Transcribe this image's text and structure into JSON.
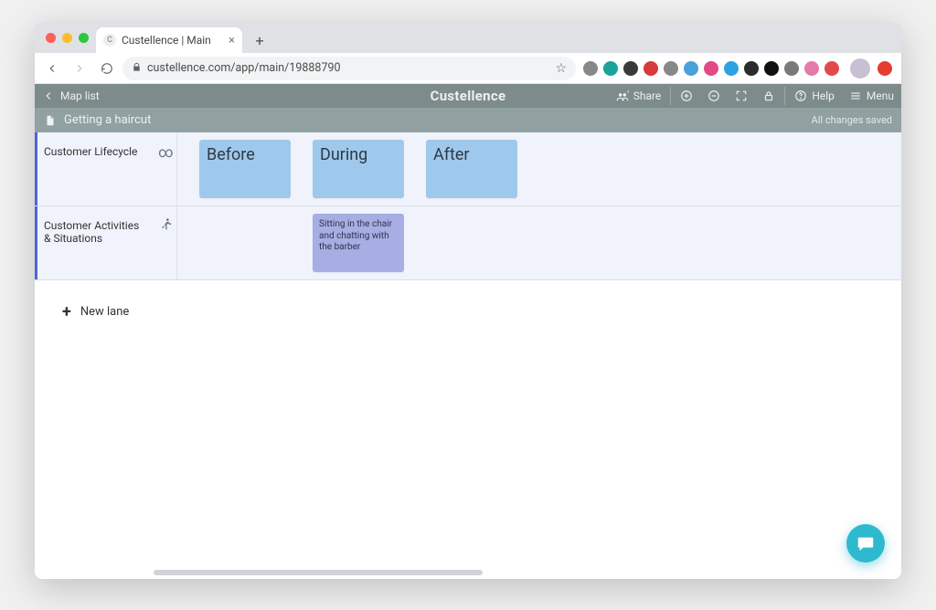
{
  "browser": {
    "tab_title": "Custellence | Main",
    "url": "custellence.com/app/main/19888790"
  },
  "header": {
    "back_label": "Map list",
    "brand": "Custellence",
    "share_label": "Share",
    "help_label": "Help",
    "menu_label": "Menu"
  },
  "doc": {
    "title": "Getting a haircut",
    "saved_status": "All changes saved"
  },
  "icons": {
    "back_arrow": "back-arrow-icon",
    "share": "share-icon",
    "plus_circle": "add-circle-icon",
    "minus_circle": "remove-circle-icon",
    "fullscreen": "fullscreen-icon",
    "lock": "lock-icon",
    "help": "help-circle-icon",
    "menu": "hamburger-icon",
    "doc": "document-icon",
    "infinity": "infinity-icon",
    "runner": "runner-icon",
    "chat": "chat-bubble-icon"
  },
  "lanes": [
    {
      "id": "lifecycle",
      "label": "Customer Lifecycle",
      "icon": "infinity",
      "cards": [
        {
          "text": "Before"
        },
        {
          "text": "During"
        },
        {
          "text": "After"
        }
      ]
    },
    {
      "id": "activities",
      "label": "Customer Activities & Situations",
      "icon": "runner",
      "cards": [
        {
          "column": 1,
          "text": "Sitting in the chair and chatting with the barber"
        }
      ]
    }
  ],
  "new_lane_label": "New lane",
  "colors": {
    "header_bg": "#7d8b8b",
    "docbar_bg": "#91a0a0",
    "lane_bg": "#f0f3fb",
    "phase_card_bg": "#9fc9ec",
    "activity_card_bg": "#a6aee4",
    "accent": "#4f64d7",
    "chat_bubble": "#2fb9cf"
  }
}
